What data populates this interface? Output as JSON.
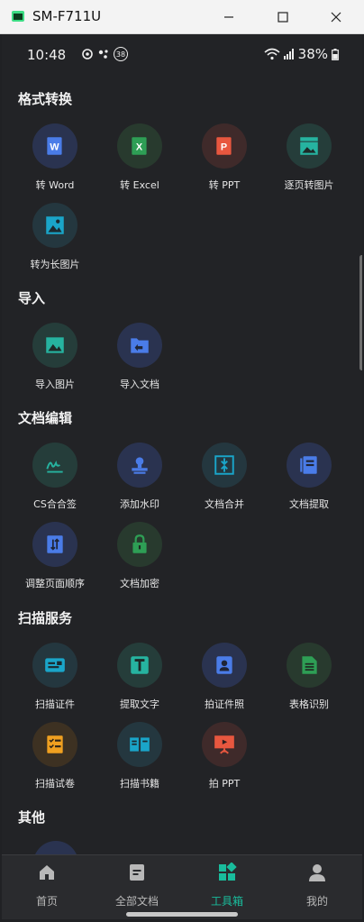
{
  "window": {
    "title": "SM-F711U"
  },
  "status": {
    "time": "10:48",
    "notif_count": "38",
    "battery": "38%"
  },
  "sections": [
    {
      "title": "格式转换",
      "tools": [
        {
          "label": "转 Word",
          "icon": "word-icon",
          "bg": "#2a3350",
          "fg": "#4a7ce8"
        },
        {
          "label": "转 Excel",
          "icon": "excel-icon",
          "bg": "#283a2e",
          "fg": "#2e9e55"
        },
        {
          "label": "转 PPT",
          "icon": "ppt-icon",
          "bg": "#3f2a2a",
          "fg": "#e8573f"
        },
        {
          "label": "逐页转图片",
          "icon": "image-pages-icon",
          "bg": "#253d3a",
          "fg": "#26b3a0"
        },
        {
          "label": "转为长图片",
          "icon": "long-image-icon",
          "bg": "#24373f",
          "fg": "#1aa5c9"
        }
      ]
    },
    {
      "title": "导入",
      "tools": [
        {
          "label": "导入图片",
          "icon": "import-image-icon",
          "bg": "#253d3a",
          "fg": "#26b3a0"
        },
        {
          "label": "导入文档",
          "icon": "import-doc-icon",
          "bg": "#2a3350",
          "fg": "#4a7ce8"
        }
      ]
    },
    {
      "title": "文档编辑",
      "tools": [
        {
          "label": "CS合合签",
          "icon": "signature-icon",
          "bg": "#253d3a",
          "fg": "#26b3a0"
        },
        {
          "label": "添加水印",
          "icon": "watermark-icon",
          "bg": "#2a3350",
          "fg": "#4a7ce8"
        },
        {
          "label": "文档合并",
          "icon": "merge-icon",
          "bg": "#24373f",
          "fg": "#1aa5c9"
        },
        {
          "label": "文档提取",
          "icon": "extract-icon",
          "bg": "#2a3350",
          "fg": "#4a7ce8"
        },
        {
          "label": "调整页面顺序",
          "icon": "reorder-icon",
          "bg": "#2a3350",
          "fg": "#4a7ce8"
        },
        {
          "label": "文档加密",
          "icon": "lock-icon",
          "bg": "#283a2e",
          "fg": "#2e9e55"
        }
      ]
    },
    {
      "title": "扫描服务",
      "tools": [
        {
          "label": "扫描证件",
          "icon": "id-card-icon",
          "bg": "#24373f",
          "fg": "#1aa5c9"
        },
        {
          "label": "提取文字",
          "icon": "text-icon",
          "bg": "#253d3a",
          "fg": "#26b3a0"
        },
        {
          "label": "拍证件照",
          "icon": "portrait-icon",
          "bg": "#2a3350",
          "fg": "#4a7ce8"
        },
        {
          "label": "表格识别",
          "icon": "table-icon",
          "bg": "#283a2e",
          "fg": "#2e9e55"
        },
        {
          "label": "扫描试卷",
          "icon": "exam-icon",
          "bg": "#3d3122",
          "fg": "#f0a020"
        },
        {
          "label": "扫描书籍",
          "icon": "book-icon",
          "bg": "#24373f",
          "fg": "#1aa5c9"
        },
        {
          "label": "拍 PPT",
          "icon": "presentation-icon",
          "bg": "#3f2a2a",
          "fg": "#e8573f"
        }
      ]
    },
    {
      "title": "其他",
      "tools": []
    }
  ],
  "nav": [
    {
      "label": "首页",
      "icon": "home-icon",
      "active": false
    },
    {
      "label": "全部文档",
      "icon": "documents-icon",
      "active": false
    },
    {
      "label": "工具箱",
      "icon": "toolbox-icon",
      "active": true
    },
    {
      "label": "我的",
      "icon": "profile-icon",
      "active": false
    }
  ],
  "colors": {
    "accent": "#19bc9c",
    "nav_inactive": "#b8b8b8",
    "background": "#222326"
  }
}
